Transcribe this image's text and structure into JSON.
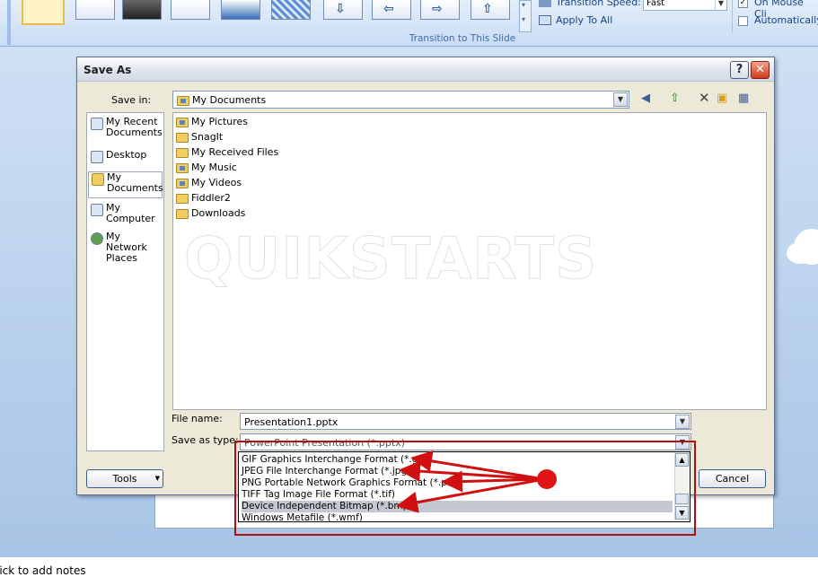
{
  "ribbon": {
    "transition_speed_label": "Transition Speed:",
    "transition_speed_value": "Fast",
    "apply_to_all_label": "Apply To All",
    "on_mouse_click_label": "On Mouse Cli",
    "on_mouse_click_checked": true,
    "automatically_label": "Automatically",
    "group_label": "Transition to This Slide"
  },
  "dialog": {
    "title": "Save As",
    "save_in_label": "Save in:",
    "save_in_value": "My Documents",
    "places": [
      {
        "label": "My Recent Documents",
        "icon": "recent-documents-icon"
      },
      {
        "label": "Desktop",
        "icon": "desktop-icon"
      },
      {
        "label": "My Documents",
        "icon": "my-documents-icon",
        "selected": true
      },
      {
        "label": "My Computer",
        "icon": "my-computer-icon"
      },
      {
        "label": "My Network Places",
        "icon": "network-places-icon"
      }
    ],
    "files": [
      "My Pictures",
      "SnagIt",
      "My Received Files",
      "My Music",
      "My Videos",
      "Fiddler2",
      "Downloads"
    ],
    "file_name_label": "File name:",
    "file_name_value": "Presentation1.pptx",
    "save_as_type_label": "Save as type:",
    "save_as_type_value": "PowerPoint Presentation (*.pptx)",
    "type_options": [
      "GIF Graphics Interchange Format (*.gif)",
      "JPEG File Interchange Format (*.jpg)",
      "PNG Portable Network Graphics Format (*.png)",
      "TIFF Tag Image File Format (*.tif)",
      "Device Independent Bitmap (*.bmp)",
      "Windows Metafile (*.wmf)"
    ],
    "highlighted_option": "Device Independent Bitmap (*.bmp)",
    "tools_label": "Tools",
    "cancel_label": "Cancel",
    "help_glyph": "?",
    "close_glyph": "✕"
  },
  "watermark": "QUIKSTARTS",
  "notes_text": "lick to add notes",
  "colors": {
    "annotation": "#d01010",
    "dialog_bg": "#ece9d8",
    "ribbon_text": "#15428b"
  }
}
